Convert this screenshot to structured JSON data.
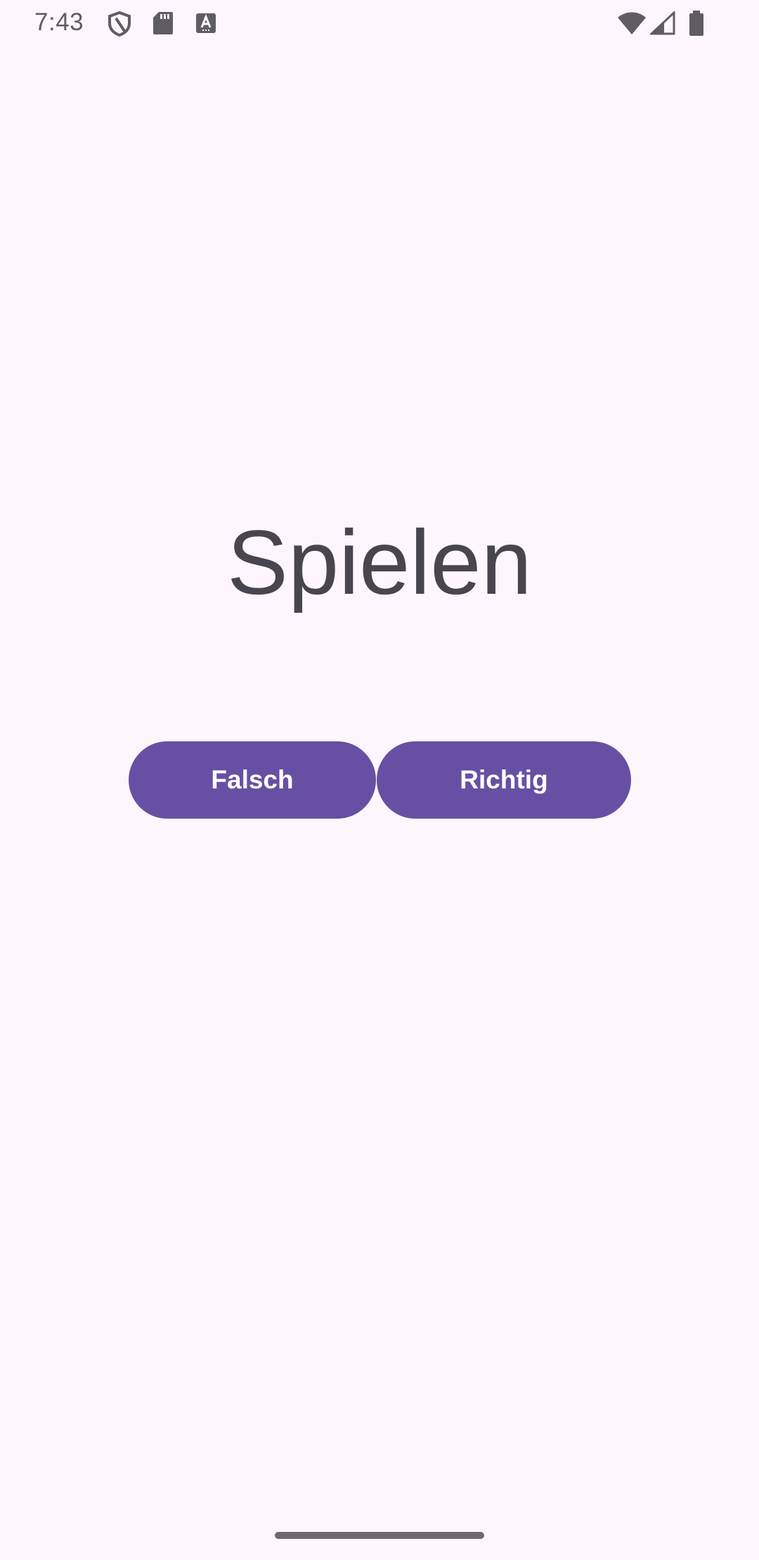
{
  "status_bar": {
    "time": "7:43",
    "icons": [
      "shield-icon",
      "sd-card-icon",
      "keyboard-a-icon",
      "wifi-icon",
      "cell-signal-icon",
      "battery-icon"
    ]
  },
  "main": {
    "title": "Spielen",
    "buttons": {
      "false_label": "Falsch",
      "true_label": "Richtig"
    }
  },
  "colors": {
    "background": "#fdf7fd",
    "primary": "#6750a4",
    "on_primary": "#ffffff",
    "title_text": "#49454f",
    "status_icons": "#5f5c63"
  }
}
